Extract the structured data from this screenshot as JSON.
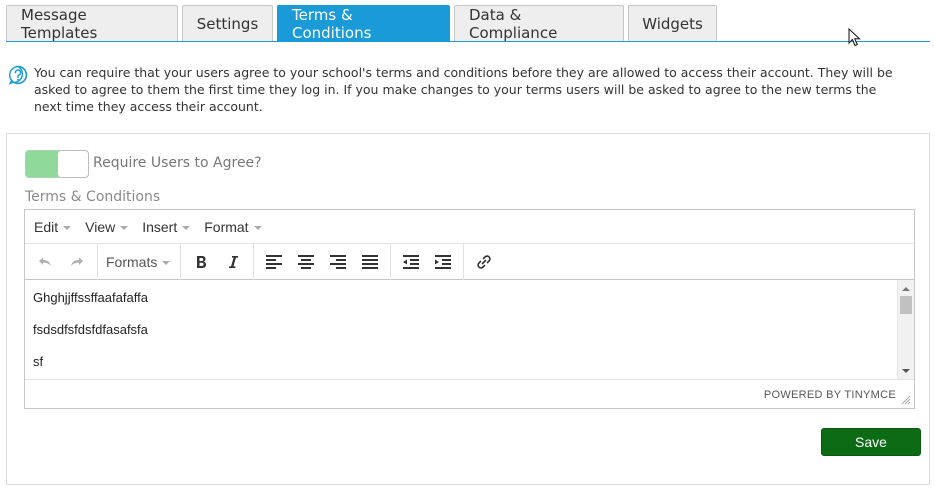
{
  "tabs": [
    {
      "label": "Message Templates",
      "active": false
    },
    {
      "label": "Settings",
      "active": false
    },
    {
      "label": "Terms & Conditions",
      "active": true
    },
    {
      "label": "Data & Compliance",
      "active": false
    },
    {
      "label": "Widgets",
      "active": false
    }
  ],
  "info": {
    "icon": "help-circle-icon",
    "text": "You can require that your users agree to your school's terms and conditions before they are allowed to access their account. They will be asked to agree to them the first time they log in. If you make changes to your terms users will be asked to agree to the new terms the next time they access their account."
  },
  "settings": {
    "require_toggle_on": true,
    "require_label": "Require Users to Agree?",
    "field_label": "Terms & Conditions"
  },
  "editor": {
    "menu": [
      "Edit",
      "View",
      "Insert",
      "Format"
    ],
    "formats_label": "Formats",
    "content": [
      "Ghghjjffssffaafafaffa",
      "fsdsdfsfdsfdfasafsfa",
      "sf"
    ],
    "powered_by": "POWERED BY TINYMCE"
  },
  "actions": {
    "save_label": "Save"
  },
  "colors": {
    "tab_active": "#1a9ad6",
    "toggle_on": "#8fd99a",
    "save": "#0e6b15"
  }
}
